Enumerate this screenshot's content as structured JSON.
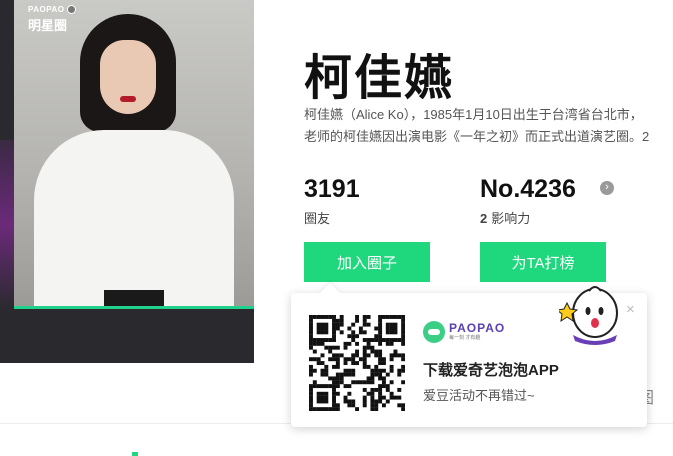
{
  "logo": {
    "brand_top": "PAOPAO",
    "brand_bottom": "明星圈"
  },
  "profile": {
    "name": "柯佳嬿",
    "bio_line1": "柯佳嬿（Alice Ko），1985年1月10日出生于台湾省台北市，",
    "bio_line2": "老师的柯佳嬿因出演电影《一年之初》而正式出道演艺圈。2"
  },
  "stats": {
    "fans_value": "3191",
    "fans_label": "圈友",
    "rank_value": "No.4236",
    "influence_level": "2",
    "influence_label": "影响力",
    "more_glyph": "›"
  },
  "actions": {
    "join_label": "加入圈子",
    "vote_label": "为TA打榜"
  },
  "popup": {
    "app_logo_text": "PAOPAO",
    "app_logo_sub": "每一刻 才有趣",
    "title": "下载爱奇艺泡泡APP",
    "subtitle": "爱豆活动不再错过~",
    "close_glyph": "×"
  },
  "lower": {
    "right_glyph": "图"
  },
  "colors": {
    "accent_green": "#1fd77d",
    "hero_dark": "#2a2a2e",
    "brand_purple": "#5b3fb3"
  }
}
